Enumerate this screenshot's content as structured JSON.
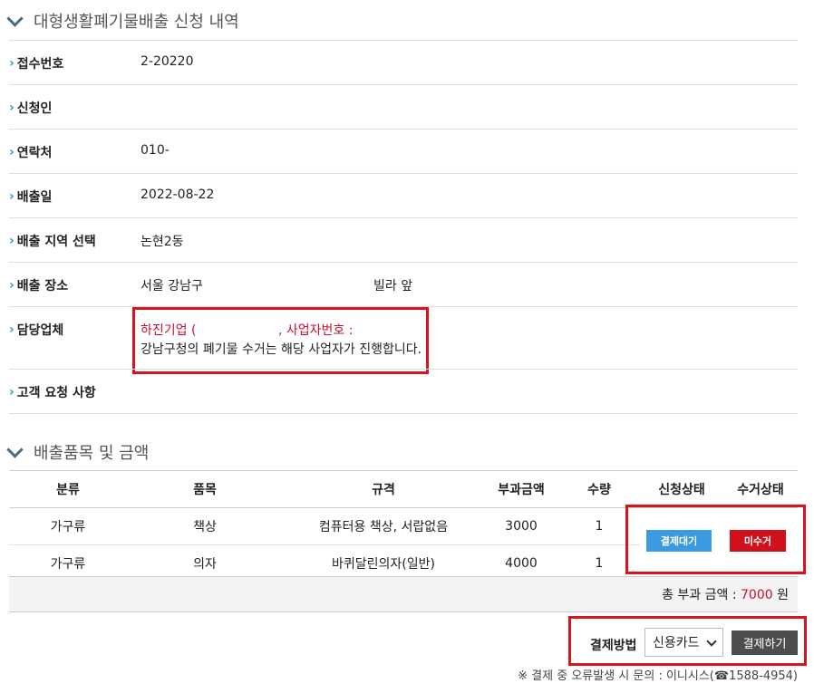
{
  "section1": {
    "title": "대형생활폐기물배출 신청 내역"
  },
  "fields": [
    {
      "label": "접수번호",
      "value": "2-20220"
    },
    {
      "label": "신청인",
      "value": ""
    },
    {
      "label": "연락처",
      "value": "010-"
    },
    {
      "label": "배출일",
      "value": "2022-08-22"
    },
    {
      "label": "배출 지역 선택",
      "value": "논현2동"
    },
    {
      "label": "배출 장소",
      "value": "서울 강남구",
      "value2": "빌라 앞"
    },
    {
      "label": "담당업체",
      "value_company": "하진기업 (",
      "value_biz": ", 사업자번호 :",
      "value_note": "강남구청의 폐기물 수거는 해당 사업자가 진행합니다."
    },
    {
      "label": "고객 요청 사항",
      "value": ""
    }
  ],
  "section2": {
    "title": "배출품목 및 금액"
  },
  "table": {
    "headers": [
      "분류",
      "품목",
      "규격",
      "부과금액",
      "수량",
      "신청상태",
      "수거상태"
    ],
    "rows": [
      [
        "가구류",
        "책상",
        "컴퓨터용 책상, 서랍없음",
        "3000",
        "1"
      ],
      [
        "가구류",
        "의자",
        "바퀴달린의자(일반)",
        "4000",
        "1"
      ]
    ],
    "status_apply": "결제대기",
    "status_collect": "미수거"
  },
  "total": {
    "label": "총 부과 금액 :",
    "amount": "7000",
    "unit": "원"
  },
  "payment": {
    "label": "결제방법",
    "selected": "신용카드",
    "button": "결제하기",
    "note": "※ 결제 중 오류발생 시 문의 : 이니시스(☎1588-4954)"
  },
  "colors": {
    "accent_teal": "#1aa0b8",
    "red": "#c8102e",
    "blue_btn": "#3b9ae0",
    "red_btn": "#d0111b"
  }
}
